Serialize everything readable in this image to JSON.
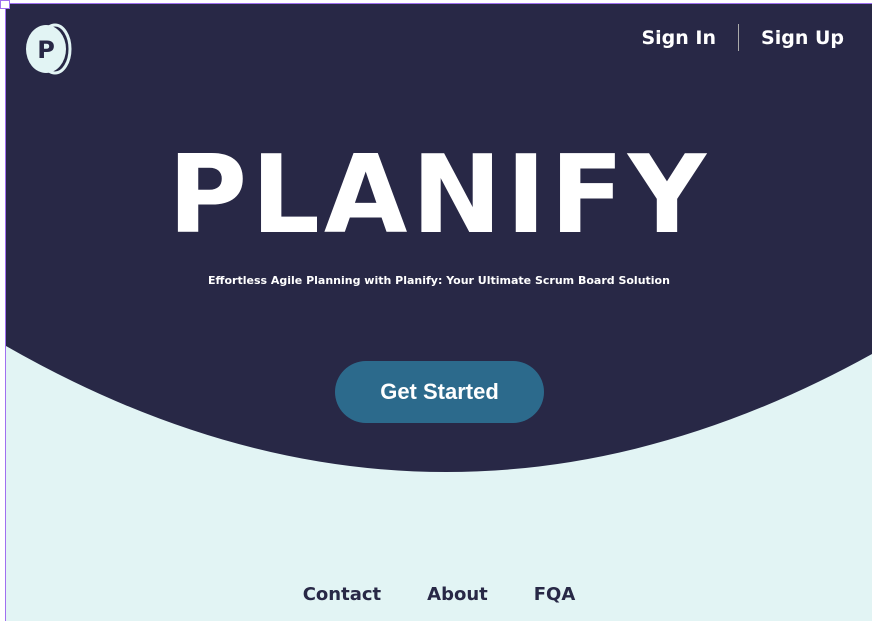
{
  "header": {
    "logo_letter": "P",
    "sign_in": "Sign In",
    "sign_up": "Sign Up"
  },
  "hero": {
    "title": "PLANIFY",
    "subtitle": "Effortless Agile Planning with Planify: Your Ultimate Scrum Board Solution",
    "cta": "Get Started"
  },
  "footer": {
    "links": [
      "Contact",
      "About",
      "FQA"
    ]
  },
  "colors": {
    "dark": "#282846",
    "light": "#e2f4f4",
    "button": "#2c6a8c"
  }
}
